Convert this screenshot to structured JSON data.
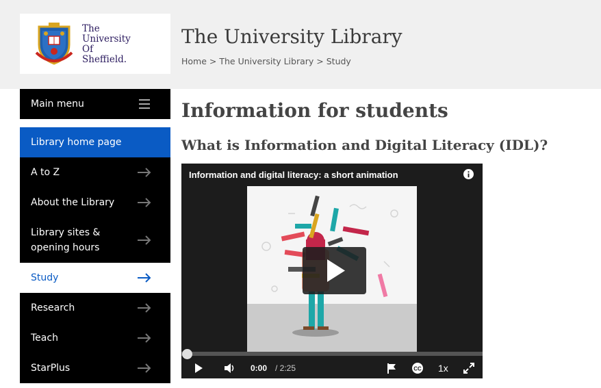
{
  "logo": {
    "line1": "The",
    "line2": "University",
    "line3": "Of",
    "line4": "Sheffield."
  },
  "header": {
    "site_title": "The University Library"
  },
  "breadcrumb": {
    "home": "Home",
    "sep": " > ",
    "library": "The University Library",
    "current": "Study"
  },
  "nav": {
    "menu_label": "Main menu",
    "home_label": "Library home page",
    "items": [
      {
        "label": "A to Z"
      },
      {
        "label": "About the Library"
      },
      {
        "label": "Library sites & opening hours"
      },
      {
        "label": "Study"
      },
      {
        "label": "Research"
      },
      {
        "label": "Teach"
      },
      {
        "label": "StarPlus"
      }
    ]
  },
  "main": {
    "title": "Information for students",
    "subtitle": "What is Information and Digital Literacy (IDL)?"
  },
  "video": {
    "title": "Information and digital literacy: a short animation",
    "current_time": "0:00",
    "duration": "/ 2:25",
    "speed": "1x",
    "progress": 0
  },
  "colors": {
    "accent": "#0a5bc4",
    "nav_bg": "#000000",
    "header_bg": "#f0f0f0"
  }
}
